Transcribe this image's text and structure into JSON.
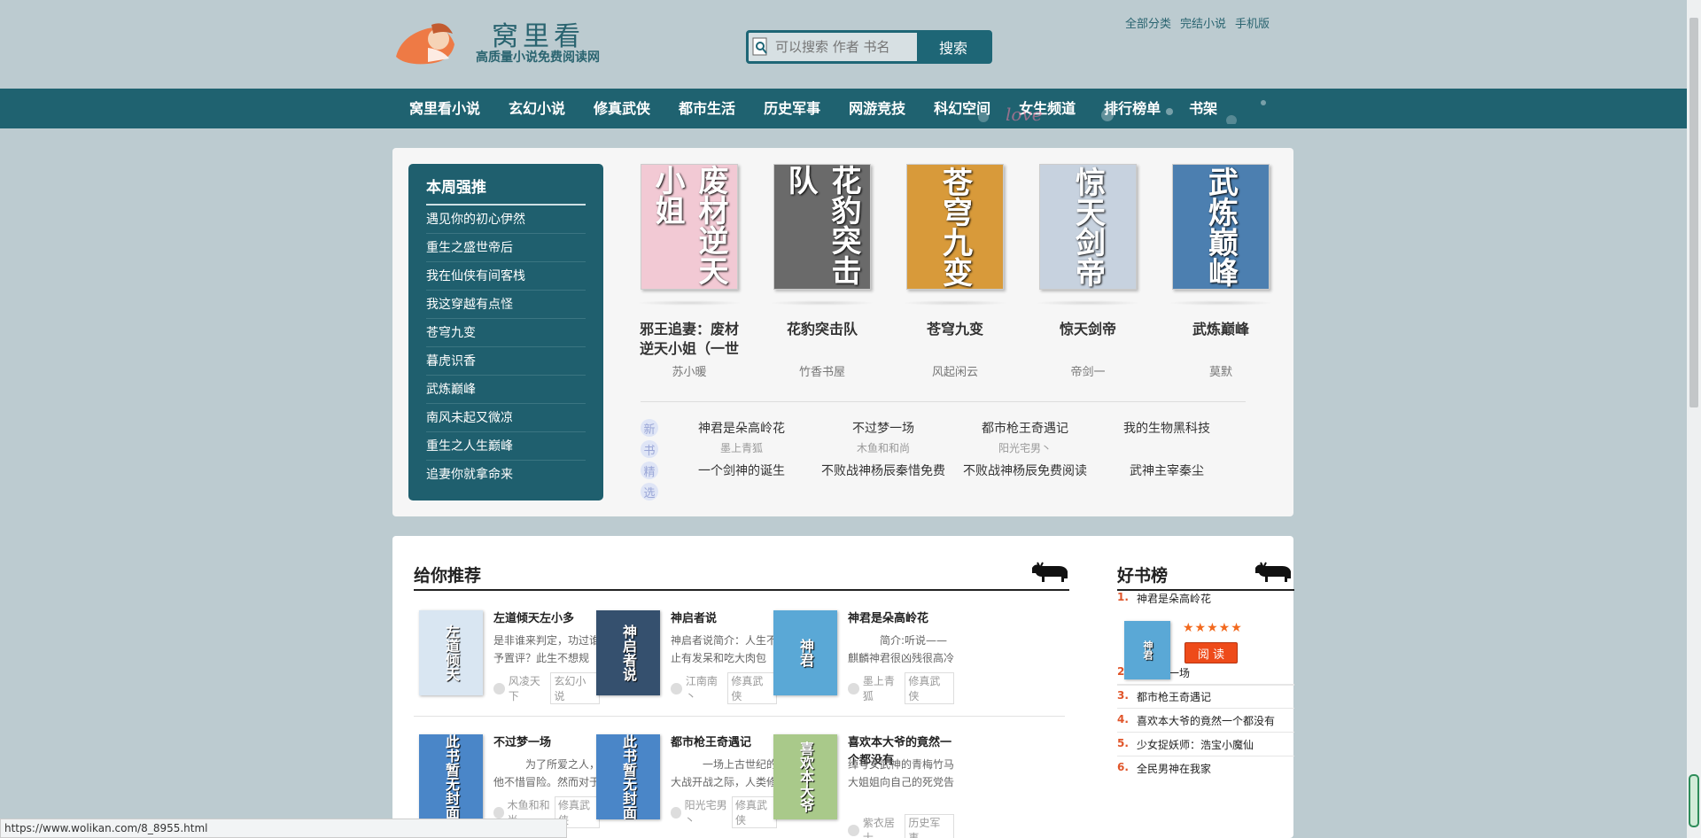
{
  "header": {
    "logo_title": "窝里看",
    "logo_sub": "高质量小说免费阅读网",
    "search_placeholder": "可以搜索 作者 书名",
    "search_button": "搜索",
    "toplinks": [
      "全部分类",
      "完结小说",
      "手机版"
    ]
  },
  "nav": {
    "items": [
      "窝里看小说",
      "玄幻小说",
      "修真武侠",
      "都市生活",
      "历史军事",
      "网游竞技",
      "科幻空间",
      "女生频道",
      "排行榜单",
      "书架"
    ],
    "deco_text": "love"
  },
  "weekly": {
    "title": "本周强推",
    "items": [
      "遇见你的初心伊然",
      "重生之盛世帝后",
      "我在仙侠有间客栈",
      "我这穿越有点怪",
      "苍穹九变",
      "暮虎识香",
      "武炼巅峰",
      "南风未起又微凉",
      "重生之人生巅峰",
      "追妻你就拿命来"
    ]
  },
  "featured": [
    {
      "title": "邪王追妻：废材逆天小姐（一世",
      "author": "苏小暖",
      "cover_text": "废材逆天小姐",
      "cover_color": "#f2c9d4"
    },
    {
      "title": "花豹突击队",
      "author": "竹香书屋",
      "cover_text": "花豹突击队",
      "cover_color": "#6a6a6a"
    },
    {
      "title": "苍穹九变",
      "author": "风起闲云",
      "cover_text": "苍穹九变",
      "cover_color": "#d89a3a"
    },
    {
      "title": "惊天剑帝",
      "author": "帝剑一",
      "cover_text": "惊天剑帝",
      "cover_color": "#c7d2df"
    },
    {
      "title": "武炼巅峰",
      "author": "莫默",
      "cover_text": "武炼巅峰",
      "cover_color": "#4c7fb0"
    }
  ],
  "newpicks": {
    "label": [
      "新",
      "书",
      "精",
      "选"
    ],
    "row1": [
      {
        "title": "神君是朵高岭花",
        "author": "墨上青狐"
      },
      {
        "title": "不过梦一场",
        "author": "木鱼和和尚"
      },
      {
        "title": "都市枪王奇遇记",
        "author": "阳光宅男丶"
      },
      {
        "title": "我的生物黑科技",
        "author": ""
      }
    ],
    "row2": [
      "一个剑神的诞生",
      "不败战神杨辰秦惜免费",
      "不败战神杨辰免费阅读",
      "武神主宰秦尘"
    ]
  },
  "recommend": {
    "title": "给你推荐",
    "items": [
      {
        "title": "左道倾天左小多",
        "desc": "是非谁来判定，功过谁予置评？此生不想规矩，只求随",
        "author": "风凌天下",
        "tag": "玄幻小说",
        "thumb_text": "左道倾天",
        "thumb_color": "#d9e6f2"
      },
      {
        "title": "神启者说",
        "desc": "神启者说简介：人生不止有发呆和吃大肉包子，还有修",
        "author": "江南南丶",
        "tag": "修真武侠",
        "thumb_text": "神启者说",
        "thumb_color": "#35506e"
      },
      {
        "title": "神君是朵高岭花",
        "desc": "简介:听说——麒麟神君很凶残很高冷很可怕",
        "author": "墨上青狐",
        "tag": "修真武侠",
        "thumb_text": "神君",
        "thumb_color": "#5aa8d6"
      },
      {
        "title": "不过梦一场",
        "desc": "为了所爱之人，他不惜冒险。然而对于无辜的",
        "author": "木鱼和和尚",
        "tag": "修真武侠",
        "thumb_text": "此书暂无封面",
        "thumb_color": "#4a86c8"
      },
      {
        "title": "都市枪王奇遇记",
        "desc": "一场上古世纪的大战开战之际，人类修炼者达",
        "author": "阳光宅男丶",
        "tag": "修真武侠",
        "thumb_text": "此书暂无封面",
        "thumb_color": "#4a86c8"
      },
      {
        "title": "喜欢本大爷的竟然一个都没有",
        "desc": "绰号女武神的青梅竹马大姐姐向自己的死党告白了。别",
        "author": "紫衣居士",
        "tag": "历史军事",
        "thumb_text": "喜欢本大爷",
        "thumb_color": "#a9c98a"
      }
    ]
  },
  "ranking": {
    "title": "好书榜",
    "stars": "★★★★★",
    "read_button": "阅 读",
    "items": [
      "神君是朵高岭花",
      "不过梦一场",
      "都市枪王奇遇记",
      "喜欢本大爷的竟然一个都没有",
      "少女捉妖师：浩宝小魔仙",
      "全民男神在我家"
    ]
  },
  "statusbar": {
    "url": "https://www.wolikan.com/8_8955.html"
  }
}
